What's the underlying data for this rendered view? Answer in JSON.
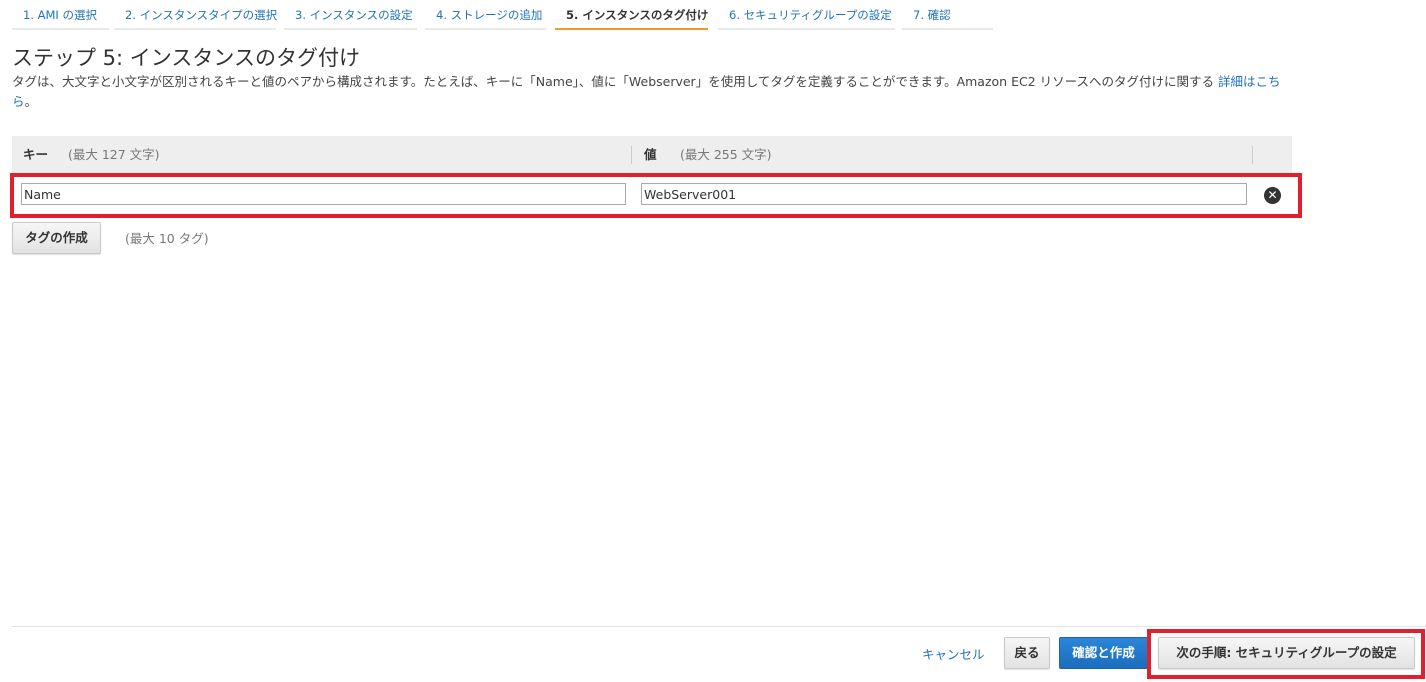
{
  "wizard": {
    "steps": [
      {
        "label": "1. AMI の選択"
      },
      {
        "label": "2. インスタンスタイプの選択"
      },
      {
        "label": "3. インスタンスの設定"
      },
      {
        "label": "4. ストレージの追加"
      },
      {
        "label": "5. インスタンスのタグ付け"
      },
      {
        "label": "6. セキュリティグループの設定"
      },
      {
        "label": "7. 確認"
      }
    ],
    "active_index": 4
  },
  "page": {
    "title": "ステップ 5: インスタンスのタグ付け",
    "description": "タグは、大文字と小文字が区別されるキーと値のペアから構成されます。たとえば、キーに「Name」、値に「Webserver」を使用してタグを定義することができます。Amazon EC2 リソースへのタグ付けに関する ",
    "learn_more": "詳細はこちら",
    "description_end": "。"
  },
  "tag_table": {
    "key_header": "キー",
    "key_hint": "(最大 127 文字)",
    "value_header": "値",
    "value_hint": "(最大 255 文字)",
    "rows": [
      {
        "key": "Name",
        "value": "WebServer001"
      }
    ],
    "remove_icon": "close-circle-icon",
    "add_tag_button": "タグの作成",
    "max_tags_hint": "(最大 10 タグ)"
  },
  "footer": {
    "cancel": "キャンセル",
    "back": "戻る",
    "review_launch": "確認と作成",
    "next": "次の手順: セキュリティグループの設定"
  },
  "colors": {
    "link": "#1f73b7",
    "active_step_underline": "#f29b2a",
    "highlight_border": "#e0212d",
    "primary_button": "#1b6dbd"
  }
}
